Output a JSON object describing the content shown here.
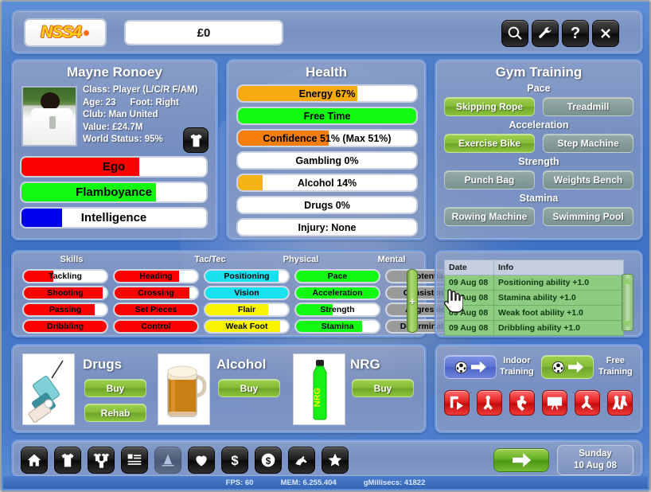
{
  "topbar": {
    "logo_text": "NSS4",
    "money": "£0",
    "buttons": [
      {
        "name": "search-button",
        "icon": "magnifier-icon"
      },
      {
        "name": "tools-button",
        "icon": "wrench-icon"
      },
      {
        "name": "help-button",
        "icon": "question-mark-icon",
        "label": "?"
      },
      {
        "name": "close-button",
        "icon": "close-x-icon"
      }
    ]
  },
  "player": {
    "name": "Mayne Ronoey",
    "class": "Class: Player (L/C/R F/AM)",
    "age": "Age: 23",
    "foot": "Foot: Right",
    "club": "Club: Man United",
    "value": "Value: £24.7M",
    "world_status": "World Status: 95%",
    "shirt_button_icon": "shirt-icon",
    "attributes": [
      {
        "label": "Ego",
        "percent": 64,
        "color": "#fc0000"
      },
      {
        "label": "Flamboyance",
        "percent": 73,
        "color": "#12f912"
      },
      {
        "label": "Intelligence",
        "percent": 22,
        "color": "#0000f0"
      }
    ]
  },
  "health": {
    "title": "Health",
    "bars": [
      {
        "label": "Energy 67%",
        "percent": 67,
        "color": "#f7aa12"
      },
      {
        "label": "Free Time",
        "percent": 100,
        "color": "#12f912"
      },
      {
        "label": "Confidence 51% (Max 51%)",
        "percent": 51,
        "color": "#f57e0c"
      },
      {
        "label": "Gambling 0%",
        "percent": 0,
        "color": "#f7aa12"
      },
      {
        "label": "Alcohol 14%",
        "percent": 14,
        "color": "#f5b317"
      },
      {
        "label": "Drugs 0%",
        "percent": 0,
        "color": "#f7aa12"
      },
      {
        "label": "Injury: None",
        "percent": 0,
        "color": "#f7aa12"
      }
    ]
  },
  "gym": {
    "title": "Gym Training",
    "groups": [
      {
        "heading": "Pace",
        "left": "Skipping Rope",
        "right": "Treadmill",
        "active": "left"
      },
      {
        "heading": "Acceleration",
        "left": "Exercise Bike",
        "right": "Step Machine",
        "active": "left"
      },
      {
        "heading": "Strength",
        "left": "Punch Bag",
        "right": "Weights Bench",
        "active": "none"
      },
      {
        "heading": "Stamina",
        "left": "Rowing Machine",
        "right": "Swimming Pool",
        "active": "none"
      }
    ]
  },
  "skills": {
    "columns": [
      "Skills",
      "Tac/Tec",
      "Physical",
      "Mental"
    ],
    "scroll_plus": "+",
    "items": [
      {
        "label": "Tackling",
        "percent": 36,
        "color": "#fc0000",
        "col": 0,
        "row": 0
      },
      {
        "label": "Shooting",
        "percent": 95,
        "color": "#fc0000",
        "col": 0,
        "row": 1
      },
      {
        "label": "Passing",
        "percent": 86,
        "color": "#fc0000",
        "col": 0,
        "row": 2
      },
      {
        "label": "Dribbling",
        "percent": 100,
        "color": "#fc0000",
        "col": 0,
        "row": 3
      },
      {
        "label": "Heading",
        "percent": 78,
        "color": "#fc0000",
        "col": 1,
        "row": 0
      },
      {
        "label": "Crossing",
        "percent": 90,
        "color": "#fc0000",
        "col": 1,
        "row": 1
      },
      {
        "label": "Set Pieces",
        "percent": 100,
        "color": "#fc0000",
        "col": 1,
        "row": 2
      },
      {
        "label": "Control",
        "percent": 100,
        "color": "#fc0000",
        "col": 1,
        "row": 3
      },
      {
        "label": "Positioning",
        "percent": 88,
        "color": "#18e0ef",
        "col": 2,
        "row": 0
      },
      {
        "label": "Vision",
        "percent": 100,
        "color": "#18e0ef",
        "col": 2,
        "row": 1
      },
      {
        "label": "Flair",
        "percent": 76,
        "color": "#f8f400",
        "col": 2,
        "row": 2
      },
      {
        "label": "Weak Foot",
        "percent": 90,
        "color": "#f8f400",
        "col": 2,
        "row": 3
      },
      {
        "label": "Pace",
        "percent": 100,
        "color": "#12f912",
        "col": 3,
        "row": 0
      },
      {
        "label": "Acceleration",
        "percent": 100,
        "color": "#12f912",
        "col": 3,
        "row": 1
      },
      {
        "label": "Strength",
        "percent": 44,
        "color": "#12f912",
        "col": 3,
        "row": 2
      },
      {
        "label": "Stamina",
        "percent": 80,
        "color": "#12f912",
        "col": 3,
        "row": 3
      },
      {
        "label": "Potential",
        "percent": 79,
        "color": "#9a9a9a",
        "col": 4,
        "row": 0
      },
      {
        "label": "Consistency",
        "percent": 80,
        "color": "#9a9a9a",
        "col": 4,
        "row": 1
      },
      {
        "label": "Aggression",
        "percent": 86,
        "color": "#9a9a9a",
        "col": 4,
        "row": 2
      },
      {
        "label": "Determination",
        "percent": 88,
        "color": "#9a9a9a",
        "col": 4,
        "row": 3
      }
    ]
  },
  "log": {
    "headers": [
      "Date",
      "Info"
    ],
    "rows": [
      {
        "date": "09 Aug 08",
        "info": "Positioning ability +1.0"
      },
      {
        "date": "09 Aug 08",
        "info": "Stamina ability +1.0"
      },
      {
        "date": "09 Aug 08",
        "info": "Weak foot ability +1.0"
      },
      {
        "date": "09 Aug 08",
        "info": "Dribbling ability +1.0"
      }
    ]
  },
  "shop": {
    "items": [
      {
        "name": "Drugs",
        "image": "syringe-image",
        "buttons": [
          "Buy",
          "Rehab"
        ]
      },
      {
        "name": "Alcohol",
        "image": "beer-mug-image",
        "buttons": [
          "Buy"
        ]
      },
      {
        "name": "NRG",
        "image": "nrg-bottle-image",
        "buttons": [
          "Buy"
        ],
        "bottle_text": "NRG"
      }
    ]
  },
  "training": {
    "indoor_label_line1": "Indoor",
    "indoor_label_line2": "Training",
    "free_label_line1": "Free",
    "free_label_line2": "Training",
    "drill_buttons": [
      "drill-corner-icon",
      "drill-player-icon",
      "drill-shooting-icon",
      "drill-goal-icon",
      "drill-running-icon",
      "drill-tackle-icon"
    ]
  },
  "bottombar": {
    "nav": [
      {
        "name": "home-button",
        "icon": "home-icon"
      },
      {
        "name": "squad-button",
        "icon": "shirt-icon"
      },
      {
        "name": "lineup-button",
        "icon": "numbered-shirts-icon"
      },
      {
        "name": "table-button",
        "icon": "list-icon"
      },
      {
        "name": "training-cone-button",
        "icon": "cone-icon"
      },
      {
        "name": "health-button",
        "icon": "heart-icon"
      },
      {
        "name": "finance-button",
        "icon": "dollar-icon"
      },
      {
        "name": "transfers-button",
        "icon": "money-ball-icon"
      },
      {
        "name": "horse-button",
        "icon": "horse-icon"
      },
      {
        "name": "favourites-button",
        "icon": "star-icon"
      }
    ],
    "next_button_icon": "arrow-right-icon",
    "date_day": "Sunday",
    "date_value": "10 Aug 08"
  },
  "status": {
    "fps": "FPS: 60",
    "mem": "MEM: 6.255.404",
    "millisecs": "gMillisecs: 41822"
  }
}
